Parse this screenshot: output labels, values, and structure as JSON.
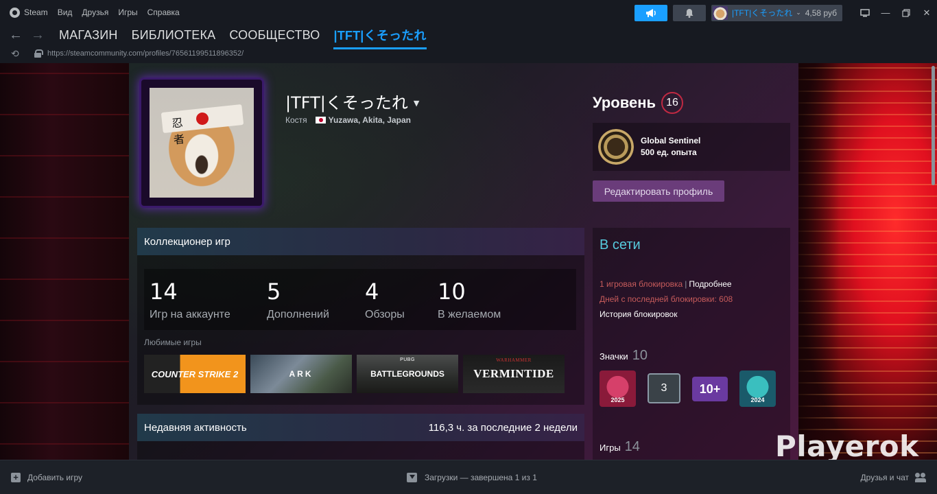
{
  "menubar": {
    "app_name": "Steam",
    "items": [
      "Вид",
      "Друзья",
      "Игры",
      "Справка"
    ],
    "account_name": "|TFT|くそったれ",
    "balance": "4,58 руб"
  },
  "nav": {
    "links": [
      "МАГАЗИН",
      "БИБЛИОТЕКА",
      "СООБЩЕСТВО"
    ],
    "active": "|TFT|くそったれ"
  },
  "url": "https://steamcommunity.com/profiles/76561199511896352/",
  "profile": {
    "persona_name": "|TFT|くそったれ",
    "real_name": "Костя",
    "location": "Yuzawa, Akita, Japan",
    "level_label": "Уровень",
    "level": "16",
    "badge_name": "Global Sentinel",
    "badge_xp": "500 ед. опыта",
    "edit_button": "Редактировать профиль"
  },
  "showcase": {
    "title": "Коллекционер игр",
    "stats": [
      {
        "value": "14",
        "label": "Игр на аккаунте"
      },
      {
        "value": "5",
        "label": "Дополнений"
      },
      {
        "value": "4",
        "label": "Обзоры"
      },
      {
        "value": "10",
        "label": "В желаемом"
      }
    ],
    "favorites_label": "Любимые игры",
    "favorites": [
      {
        "title": "COUNTER STRIKE 2"
      },
      {
        "title": "ARK"
      },
      {
        "title": "BATTLEGROUNDS",
        "sub": "PUBG"
      },
      {
        "title": "VERMINTIDE",
        "sub": "WARHAMMER"
      }
    ]
  },
  "recent": {
    "title": "Недавняя активность",
    "hours": "116,3 ч. за последние 2 недели"
  },
  "right": {
    "online": "В сети",
    "ban_text": "1 игровая блокировка",
    "ban_sep": "|",
    "ban_more": "Подробнее",
    "days_since": "Дней с последней блокировки: 608",
    "ban_history": "История блокировок",
    "badges_label": "Значки",
    "badges_count": "10",
    "badges": [
      "2025",
      "3",
      "10+",
      "2024"
    ],
    "games_label": "Игры",
    "games_count": "14"
  },
  "watermark": "Playerok",
  "footer": {
    "add_game": "Добавить игру",
    "downloads": "Загрузки — завершена 1 из 1",
    "friends": "Друзья и чат"
  },
  "colors": {
    "accent": "#1a9fff",
    "online": "#57cbde",
    "ban": "#c75b5b",
    "level_ring": "#c02942",
    "edit_button": "#6a3c7a"
  }
}
